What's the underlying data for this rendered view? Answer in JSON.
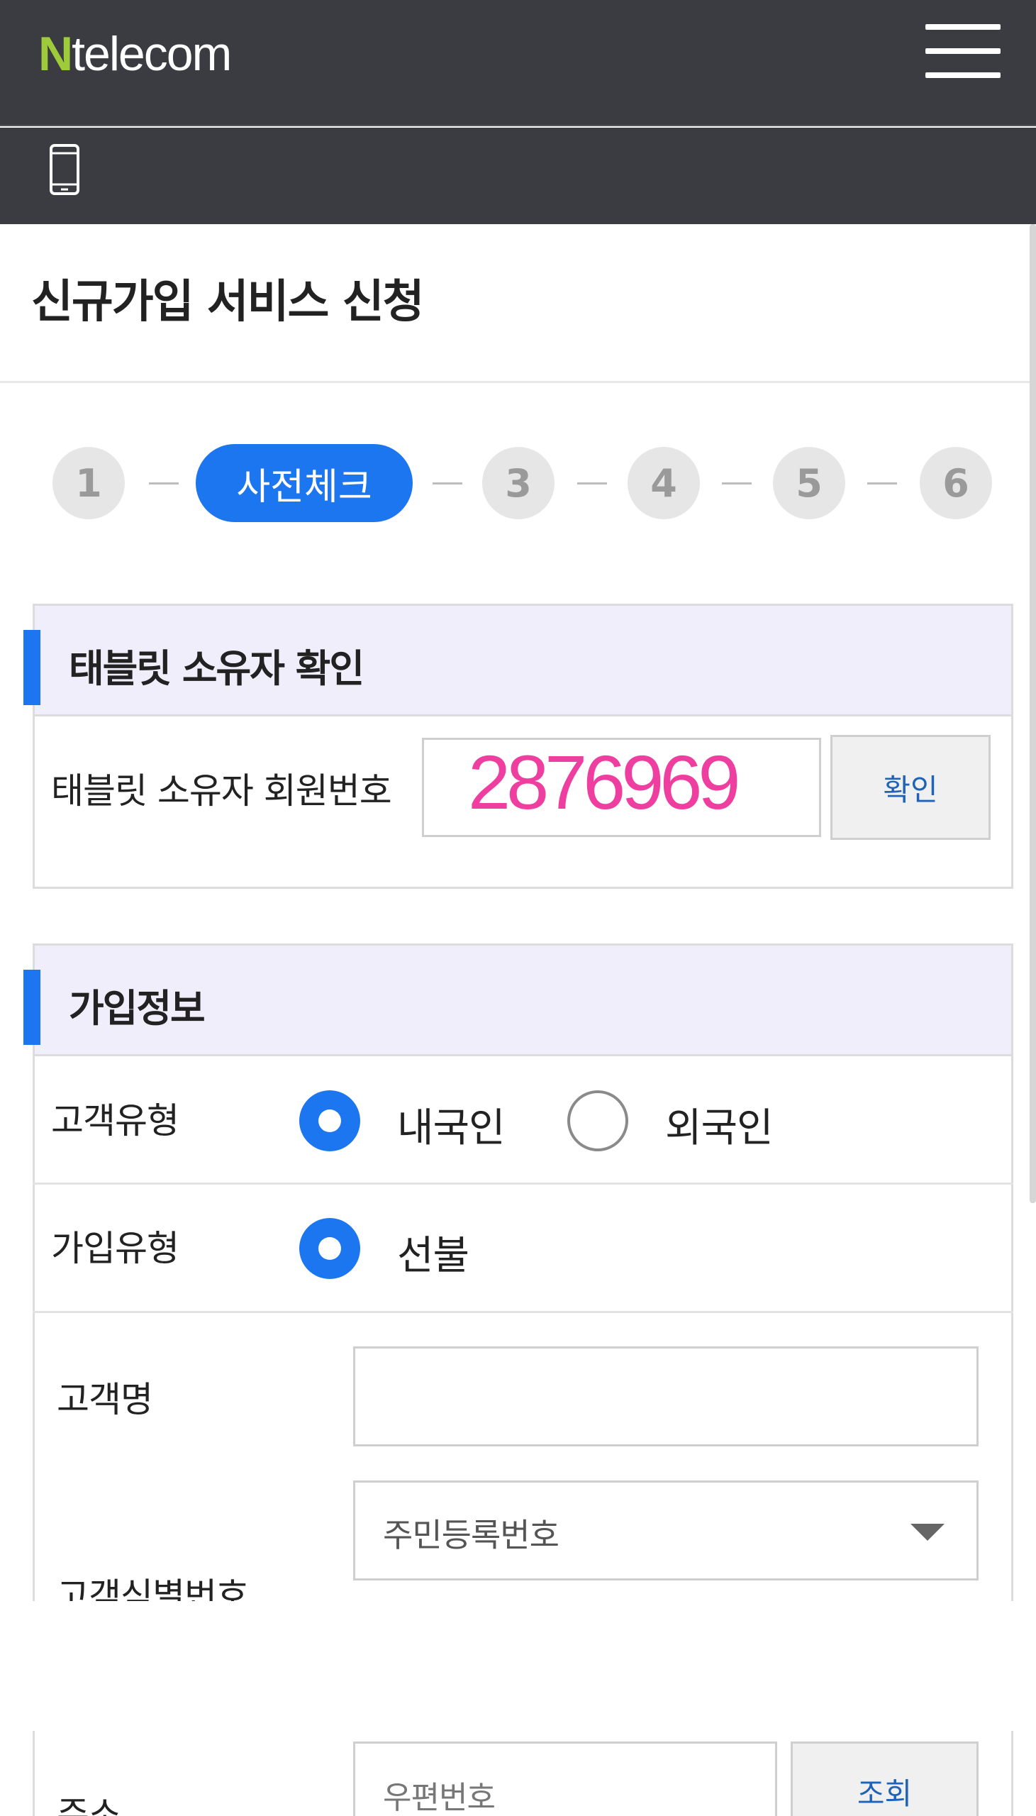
{
  "header": {
    "logo_n": "N",
    "logo_rest": "telecom",
    "menu_icon": "hamburger-menu-icon",
    "device_icon": "mobile-phone-icon"
  },
  "page": {
    "title": "신규가입 서비스 신청"
  },
  "stepper": {
    "steps": [
      "1",
      "사전체크",
      "3",
      "4",
      "5",
      "6"
    ],
    "active_index": 1
  },
  "owner_section": {
    "heading": "태블릿 소유자 확인",
    "member_label": "태블릿 소유자 회원번호",
    "member_value": "2876969",
    "confirm_button": "확인"
  },
  "signup_section": {
    "heading": "가입정보",
    "customer_type_label": "고객유형",
    "customer_type_options": [
      "내국인",
      "외국인"
    ],
    "customer_type_selected": "내국인",
    "join_type_label": "가입유형",
    "join_type_options": [
      "선불"
    ],
    "join_type_selected": "선불",
    "customer_name_label": "고객명",
    "customer_name_value": "",
    "customer_id_label": "고객식별번호",
    "customer_id_type": "주민등록번호",
    "address_label": "주소",
    "zip_placeholder": "우편번호",
    "lookup_button": "조회"
  },
  "colors": {
    "header_bg": "#3b3c41",
    "accent": "#1c76f0",
    "logo_green": "#9ecb3a",
    "section_head_bg": "#f1eefc",
    "member_value": "#ee3fa0"
  }
}
